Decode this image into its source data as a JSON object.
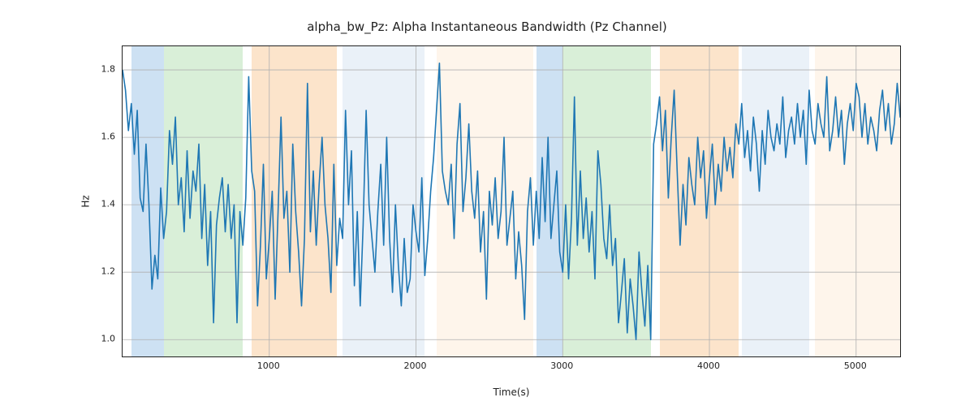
{
  "chart_data": {
    "type": "line",
    "title": "alpha_bw_Pz: Alpha Instantaneous Bandwidth (Pz Channel)",
    "xlabel": "Time(s)",
    "ylabel": "Hz",
    "xlim": [
      0,
      5300
    ],
    "ylim": [
      0.95,
      1.87
    ],
    "xticks": [
      1000,
      2000,
      3000,
      4000,
      5000
    ],
    "yticks": [
      1.0,
      1.2,
      1.4,
      1.6,
      1.8
    ],
    "regions": [
      {
        "x0": 60,
        "x1": 280,
        "class": "blue"
      },
      {
        "x0": 280,
        "x1": 820,
        "class": "green"
      },
      {
        "x0": 880,
        "x1": 1460,
        "class": "orange"
      },
      {
        "x0": 1500,
        "x1": 2060,
        "class": "ltblue"
      },
      {
        "x0": 2140,
        "x1": 2800,
        "class": "cream"
      },
      {
        "x0": 2820,
        "x1": 3000,
        "class": "blue"
      },
      {
        "x0": 3000,
        "x1": 3600,
        "class": "green"
      },
      {
        "x0": 3660,
        "x1": 4200,
        "class": "orange"
      },
      {
        "x0": 4220,
        "x1": 4680,
        "class": "ltblue"
      },
      {
        "x0": 4720,
        "x1": 5300,
        "class": "cream"
      }
    ],
    "series": [
      {
        "name": "alpha_bw_Pz",
        "color": "#1f77b4",
        "x_start": 0,
        "x_step": 20,
        "values": [
          1.8,
          1.74,
          1.62,
          1.7,
          1.55,
          1.68,
          1.42,
          1.38,
          1.58,
          1.4,
          1.15,
          1.25,
          1.18,
          1.45,
          1.3,
          1.38,
          1.62,
          1.52,
          1.66,
          1.4,
          1.48,
          1.32,
          1.56,
          1.36,
          1.5,
          1.44,
          1.58,
          1.3,
          1.46,
          1.22,
          1.38,
          1.05,
          1.34,
          1.42,
          1.48,
          1.32,
          1.46,
          1.3,
          1.4,
          1.05,
          1.38,
          1.28,
          1.42,
          1.78,
          1.5,
          1.44,
          1.1,
          1.28,
          1.52,
          1.18,
          1.3,
          1.44,
          1.12,
          1.38,
          1.66,
          1.36,
          1.44,
          1.2,
          1.58,
          1.38,
          1.26,
          1.1,
          1.3,
          1.76,
          1.32,
          1.5,
          1.28,
          1.46,
          1.6,
          1.4,
          1.3,
          1.14,
          1.52,
          1.22,
          1.36,
          1.3,
          1.68,
          1.4,
          1.56,
          1.16,
          1.38,
          1.1,
          1.34,
          1.68,
          1.4,
          1.3,
          1.2,
          1.38,
          1.52,
          1.28,
          1.6,
          1.3,
          1.14,
          1.4,
          1.22,
          1.1,
          1.3,
          1.14,
          1.18,
          1.4,
          1.32,
          1.26,
          1.48,
          1.19,
          1.3,
          1.44,
          1.54,
          1.68,
          1.82,
          1.5,
          1.44,
          1.4,
          1.52,
          1.3,
          1.58,
          1.7,
          1.38,
          1.48,
          1.64,
          1.44,
          1.36,
          1.5,
          1.26,
          1.38,
          1.12,
          1.44,
          1.34,
          1.48,
          1.3,
          1.38,
          1.6,
          1.28,
          1.36,
          1.44,
          1.18,
          1.32,
          1.22,
          1.06,
          1.38,
          1.48,
          1.28,
          1.44,
          1.3,
          1.54,
          1.35,
          1.6,
          1.3,
          1.4,
          1.5,
          1.26,
          1.2,
          1.4,
          1.18,
          1.36,
          1.72,
          1.28,
          1.5,
          1.3,
          1.42,
          1.26,
          1.38,
          1.18,
          1.56,
          1.46,
          1.3,
          1.24,
          1.4,
          1.22,
          1.3,
          1.05,
          1.14,
          1.24,
          1.02,
          1.18,
          1.1,
          1.0,
          1.26,
          1.14,
          1.04,
          1.22,
          1.0,
          1.58,
          1.64,
          1.72,
          1.56,
          1.68,
          1.42,
          1.6,
          1.74,
          1.5,
          1.28,
          1.46,
          1.34,
          1.54,
          1.46,
          1.4,
          1.6,
          1.48,
          1.56,
          1.36,
          1.48,
          1.58,
          1.4,
          1.52,
          1.44,
          1.6,
          1.5,
          1.57,
          1.48,
          1.64,
          1.58,
          1.7,
          1.54,
          1.62,
          1.5,
          1.66,
          1.58,
          1.44,
          1.62,
          1.52,
          1.68,
          1.6,
          1.56,
          1.64,
          1.58,
          1.72,
          1.54,
          1.62,
          1.66,
          1.58,
          1.7,
          1.6,
          1.68,
          1.52,
          1.74,
          1.62,
          1.58,
          1.7,
          1.64,
          1.6,
          1.78,
          1.56,
          1.62,
          1.72,
          1.6,
          1.68,
          1.52,
          1.64,
          1.7,
          1.62,
          1.76,
          1.72,
          1.6,
          1.7,
          1.58,
          1.66,
          1.62,
          1.56,
          1.68,
          1.74,
          1.62,
          1.7,
          1.58,
          1.64,
          1.76,
          1.66,
          1.72
        ]
      }
    ]
  }
}
